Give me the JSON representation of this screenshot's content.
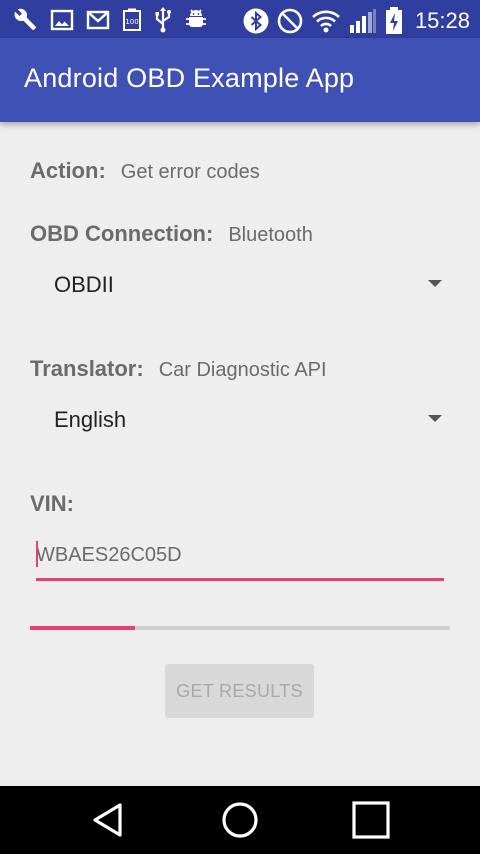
{
  "status_bar": {
    "time": "15:28",
    "left_icons": [
      "wrench-icon",
      "image-icon",
      "gmail-icon",
      "battery-100-icon",
      "usb-icon",
      "android-debug-icon"
    ],
    "right_icons": [
      "bluetooth-icon",
      "do-not-disturb-icon",
      "wifi-icon",
      "signal-icon",
      "battery-charging-icon"
    ]
  },
  "app_bar": {
    "title": "Android OBD Example App"
  },
  "form": {
    "action_label": "Action:",
    "action_value": "Get error codes",
    "connection_label": "OBD Connection:",
    "connection_value": "Bluetooth",
    "connection_spinner_value": "OBDII",
    "translator_label": "Translator:",
    "translator_value": "Car Diagnostic API",
    "language_spinner_value": "English",
    "vin_label": "VIN:",
    "vin_value": "WBAES26C05D",
    "progress_percent": 25,
    "submit_label": "GET RESULTS"
  },
  "nav_bar": {
    "icons": [
      "back-icon",
      "home-icon",
      "recents-icon"
    ]
  },
  "colors": {
    "status_bar": "#303f9f",
    "app_bar": "#3f51b5",
    "accent": "#e6407a",
    "background": "#eeeeee"
  }
}
